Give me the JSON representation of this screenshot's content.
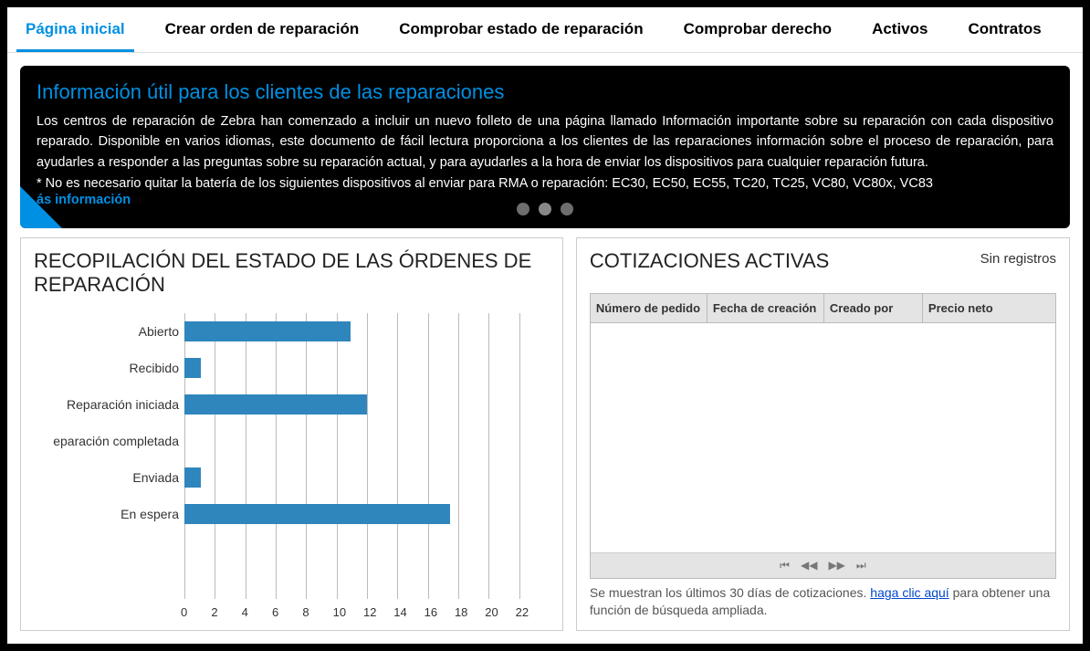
{
  "tabs": [
    {
      "label": "Página inicial",
      "active": true
    },
    {
      "label": "Crear orden de reparación",
      "active": false
    },
    {
      "label": "Comprobar estado de reparación",
      "active": false
    },
    {
      "label": "Comprobar derecho",
      "active": false
    },
    {
      "label": "Activos",
      "active": false
    },
    {
      "label": "Contratos",
      "active": false
    }
  ],
  "banner": {
    "title": "Información útil para los clientes de las reparaciones",
    "body": "Los centros de reparación de Zebra han comenzado a incluir un nuevo folleto de una página llamado Información importante sobre su reparación con cada dispositivo reparado. Disponible en varios idiomas, este documento de fácil lectura proporciona a los clientes de las reparaciones información sobre el proceso de reparación, para ayudarles a responder a las preguntas sobre su reparación actual, y para ayudarles a la hora de enviar los dispositivos para cualquier reparación futura.",
    "footnote": "* No es necesario quitar la batería de los siguientes dispositivos al enviar para RMA o reparación: EC30, EC50, EC55, TC20, TC25, VC80, VC80x, VC83",
    "more_link": "ás información",
    "dots_count": 3,
    "active_dot": 1
  },
  "left_panel": {
    "title": "RECOPILACIÓN DEL ESTADO DE LAS ÓRDENES DE REPARACIÓN"
  },
  "chart_data": {
    "type": "bar",
    "orientation": "horizontal",
    "categories": [
      "Abierto",
      "Recibido",
      "Reparación iniciada",
      "eparación completada",
      "Enviada",
      "En espera"
    ],
    "values": [
      10,
      1,
      11,
      0,
      1,
      16
    ],
    "ticks": [
      0,
      2,
      4,
      6,
      8,
      10,
      12,
      14,
      16,
      18,
      20,
      22
    ],
    "xmax": 22,
    "xlabel": "",
    "ylabel": ""
  },
  "right_panel": {
    "title": "COTIZACIONES ACTIVAS",
    "no_records": "Sin registros",
    "columns": [
      "Número de pedido",
      "Fecha de creación",
      "Creado por",
      "Precio neto"
    ],
    "footer_pre": "Se muestran los últimos 30 días de cotizaciones. ",
    "footer_link": " haga clic aquí",
    "footer_post": " para obtener una función de búsqueda ampliada."
  }
}
